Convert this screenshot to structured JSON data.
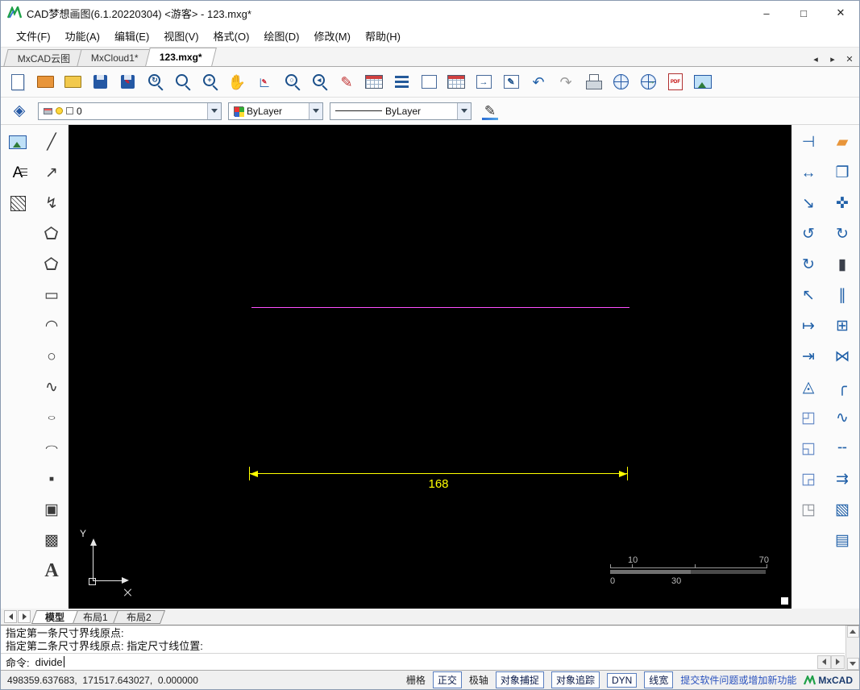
{
  "window": {
    "title": "CAD梦想画图(6.1.20220304) <游客> - 123.mxg*",
    "minimize": "–",
    "maximize": "□",
    "close": "✕"
  },
  "menubar": {
    "items": [
      {
        "name": "menu-file",
        "label": "文件(F)"
      },
      {
        "name": "menu-function",
        "label": "功能(A)"
      },
      {
        "name": "menu-edit",
        "label": "编辑(E)"
      },
      {
        "name": "menu-view",
        "label": "视图(V)"
      },
      {
        "name": "menu-format",
        "label": "格式(O)"
      },
      {
        "name": "menu-draw",
        "label": "绘图(D)"
      },
      {
        "name": "menu-modify",
        "label": "修改(M)"
      },
      {
        "name": "menu-help",
        "label": "帮助(H)"
      }
    ]
  },
  "doc_tabs": {
    "items": [
      {
        "name": "tab-mxcad-cloud",
        "label": "MxCAD云图",
        "active": false
      },
      {
        "name": "tab-mxcloud1",
        "label": "MxCloud1*",
        "active": false
      },
      {
        "name": "tab-123mxg",
        "label": "123.mxg*",
        "active": true
      }
    ],
    "controls": [
      {
        "name": "tab-scroll-left-button",
        "glyph": "◂"
      },
      {
        "name": "tab-scroll-right-button",
        "glyph": "▸"
      },
      {
        "name": "tab-close-button",
        "glyph": "✕"
      }
    ]
  },
  "toolbar": {
    "buttons": [
      {
        "name": "new-button",
        "icon": "i-page"
      },
      {
        "name": "open-cloud-button",
        "icon": "i-folder fc-orange"
      },
      {
        "name": "open-button",
        "icon": "i-folder"
      },
      {
        "name": "save-button",
        "icon": "i-floppy"
      },
      {
        "name": "save-as-button",
        "icon": "i-floppy",
        "overlay": "✎"
      },
      {
        "name": "zoom-dynamic-button",
        "icon": "i-mag",
        "overlay": "↻"
      },
      {
        "name": "zoom-window-button",
        "icon": "i-mag"
      },
      {
        "name": "zoom-in-button",
        "icon": "i-mag",
        "overlay": "+"
      },
      {
        "name": "pan-button",
        "glyph": "✋",
        "color": "#c9a06a"
      },
      {
        "name": "zoom-scale-button",
        "glyph": "∟",
        "color": "#1f5fa8",
        "overlay": "✎"
      },
      {
        "name": "zoom-all-button",
        "icon": "i-mag",
        "overlay": "○"
      },
      {
        "name": "zoom-previous-button",
        "icon": "i-mag",
        "overlay": "◂"
      },
      {
        "name": "draw-pencil-button",
        "glyph": "✎",
        "color": "#c03030"
      },
      {
        "name": "layer-palette-button",
        "icon": "i-table"
      },
      {
        "name": "linetype-list-button",
        "icon": "i-lines"
      },
      {
        "name": "text-style-button",
        "icon": "i-rectfold"
      },
      {
        "name": "block-palette-button",
        "icon": "i-table"
      },
      {
        "name": "insert-block-button",
        "icon": "i-rectfold",
        "overlay": "→"
      },
      {
        "name": "block-edit-button",
        "icon": "i-rectfold",
        "overlay": "✎"
      },
      {
        "name": "undo-button",
        "glyph": "↶",
        "color": "#1f5fa8"
      },
      {
        "name": "redo-button",
        "glyph": "↷",
        "color": "#9a9a9a"
      },
      {
        "name": "print-button",
        "icon": "i-printer"
      },
      {
        "name": "web-publish-button",
        "icon": "i-globe"
      },
      {
        "name": "web-share-button",
        "icon": "i-globe",
        "overlay": "→"
      },
      {
        "name": "pdf-export-button",
        "icon": "i-doc",
        "overlay": "PDF"
      },
      {
        "name": "image-export-button",
        "icon": "i-img"
      }
    ]
  },
  "properties_bar": {
    "layer": {
      "value": "0"
    },
    "color": {
      "value": "ByLayer"
    },
    "linetype": {
      "value": "ByLayer"
    }
  },
  "left_tools": {
    "col1": [
      {
        "name": "insert-image-button",
        "icon": "i-img"
      },
      {
        "name": "text-lines-button",
        "glyph": "A",
        "icon": "i-textlines"
      },
      {
        "name": "hatch-button",
        "icon": "i-hatch"
      }
    ],
    "col2": [
      {
        "name": "line-button",
        "glyph": "╱",
        "color": "#3a3a3a"
      },
      {
        "name": "xline-button",
        "glyph": "↗",
        "color": "#3a3a3a"
      },
      {
        "name": "polyline-button",
        "glyph": "↯",
        "color": "#3a3a3a"
      },
      {
        "name": "polygon-button",
        "icon": "i-pent"
      },
      {
        "name": "closed-polyline-button",
        "icon": "i-pent"
      },
      {
        "name": "rectangle-button",
        "glyph": "▭",
        "color": "#3a3a3a"
      },
      {
        "name": "arc-button",
        "glyph": "◠",
        "color": "#3a3a3a"
      },
      {
        "name": "circle-button",
        "glyph": "○",
        "color": "#3a3a3a"
      },
      {
        "name": "spline-button",
        "glyph": "∿",
        "color": "#3a3a3a"
      },
      {
        "name": "ellipse-button",
        "glyph": "○",
        "cls": "squish",
        "color": "#3a3a3a"
      },
      {
        "name": "ellipse-arc-button",
        "glyph": "◠",
        "cls": "squish",
        "color": "#3a3a3a"
      },
      {
        "name": "point-button",
        "glyph": "▪",
        "color": "#3a3a3a"
      },
      {
        "name": "block-button",
        "glyph": "▣",
        "color": "#3a3a3a"
      },
      {
        "name": "wipeout-button",
        "glyph": "▩",
        "color": "#3a3a3a"
      },
      {
        "name": "text-button",
        "glyph": "A",
        "cls": "bigA",
        "color": "#3a3a3a"
      }
    ]
  },
  "right_tools": {
    "col1": [
      {
        "name": "break-at-point-button",
        "glyph": "⊣",
        "color": "#2060a8"
      },
      {
        "name": "stretch-button",
        "glyph": "↔",
        "color": "#2060a8"
      },
      {
        "name": "lengthen-button",
        "glyph": "↘",
        "color": "#2060a8"
      },
      {
        "name": "rotate-ccw-button",
        "glyph": "↺",
        "color": "#2060a8"
      },
      {
        "name": "rotate-cw-button",
        "glyph": "↻",
        "color": "#2060a8"
      },
      {
        "name": "scale-up-button",
        "glyph": "↖",
        "color": "#2060a8"
      },
      {
        "name": "extend-button",
        "glyph": "↦",
        "color": "#2060a8"
      },
      {
        "name": "trim-to-edge-button",
        "glyph": "⇥",
        "color": "#2060a8"
      },
      {
        "name": "align-button",
        "glyph": "◬",
        "color": "#2060a8"
      },
      {
        "name": "draw-order-front-button",
        "glyph": "◰",
        "color": "#5b82c2"
      },
      {
        "name": "draw-order-back-button",
        "glyph": "◱",
        "color": "#5b82c2"
      },
      {
        "name": "draw-order-above-button",
        "glyph": "◲",
        "color": "#5b82c2"
      },
      {
        "name": "draw-order-below-button",
        "glyph": "◳",
        "color": "#8a8f96"
      }
    ],
    "col2": [
      {
        "name": "erase-button",
        "glyph": "▰",
        "color": "#e8953a"
      },
      {
        "name": "copy-button",
        "glyph": "❐",
        "color": "#2060a8"
      },
      {
        "name": "move-button",
        "glyph": "✜",
        "color": "#2060a8"
      },
      {
        "name": "rotate-button",
        "glyph": "↻",
        "color": "#2060a8"
      },
      {
        "name": "fill-rect-button",
        "glyph": "▮",
        "color": "#3a3f4a"
      },
      {
        "name": "offset-button",
        "glyph": "∥",
        "color": "#2060a8"
      },
      {
        "name": "array-button",
        "glyph": "⊞",
        "color": "#2060a8"
      },
      {
        "name": "mirror-button",
        "glyph": "⋈",
        "color": "#2060a8"
      },
      {
        "name": "fillet-button",
        "glyph": "╭",
        "color": "#2060a8"
      },
      {
        "name": "spline-edit-button",
        "glyph": "∿",
        "color": "#2060a8"
      },
      {
        "name": "break-button",
        "glyph": "╌",
        "color": "#2060a8"
      },
      {
        "name": "explode-button",
        "glyph": "⇉",
        "color": "#2060a8"
      },
      {
        "name": "box-3d-button",
        "glyph": "▧",
        "color": "#2060a8"
      },
      {
        "name": "paste-button",
        "glyph": "▤",
        "color": "#2060a8"
      }
    ]
  },
  "canvas": {
    "dimension": {
      "text": "168"
    },
    "ucs": {
      "y_label": "Y"
    },
    "ruler": {
      "top_left": "10",
      "top_right": "70",
      "bottom_left": "0",
      "bottom_mid": "30"
    },
    "colors": {
      "line_magenta": "#ff4fff",
      "dimension_yellow": "#ffff00",
      "background": "#000000"
    }
  },
  "layout_tabs": {
    "items": [
      {
        "name": "layout-tab-model",
        "label": "模型",
        "active": true
      },
      {
        "name": "layout-tab-1",
        "label": "布局1",
        "active": false
      },
      {
        "name": "layout-tab-2",
        "label": "布局2",
        "active": false
      }
    ]
  },
  "command": {
    "history": [
      {
        "text": "指定第一条尺寸界线原点:"
      },
      {
        "text": "指定第二条尺寸界线原点:  指定尺寸线位置:"
      }
    ],
    "prompt": "命令:",
    "input": "divide"
  },
  "statusbar": {
    "coordinates": "498359.637683,  171517.643027,  0.000000",
    "toggles": [
      {
        "name": "toggle-grid",
        "label": "栅格",
        "boxed": false
      },
      {
        "name": "toggle-ortho",
        "label": "正交",
        "boxed": true
      },
      {
        "name": "toggle-polar",
        "label": "极轴",
        "boxed": false
      },
      {
        "name": "toggle-osnap",
        "label": "对象捕捉",
        "boxed": true
      },
      {
        "name": "toggle-otrack",
        "label": "对象追踪",
        "boxed": true
      },
      {
        "name": "toggle-dyn",
        "label": "DYN",
        "boxed": true
      },
      {
        "name": "toggle-lineweight",
        "label": "线宽",
        "boxed": true
      }
    ],
    "feedback_link": "提交软件问题或增加新功能",
    "brand": "MxCAD"
  }
}
